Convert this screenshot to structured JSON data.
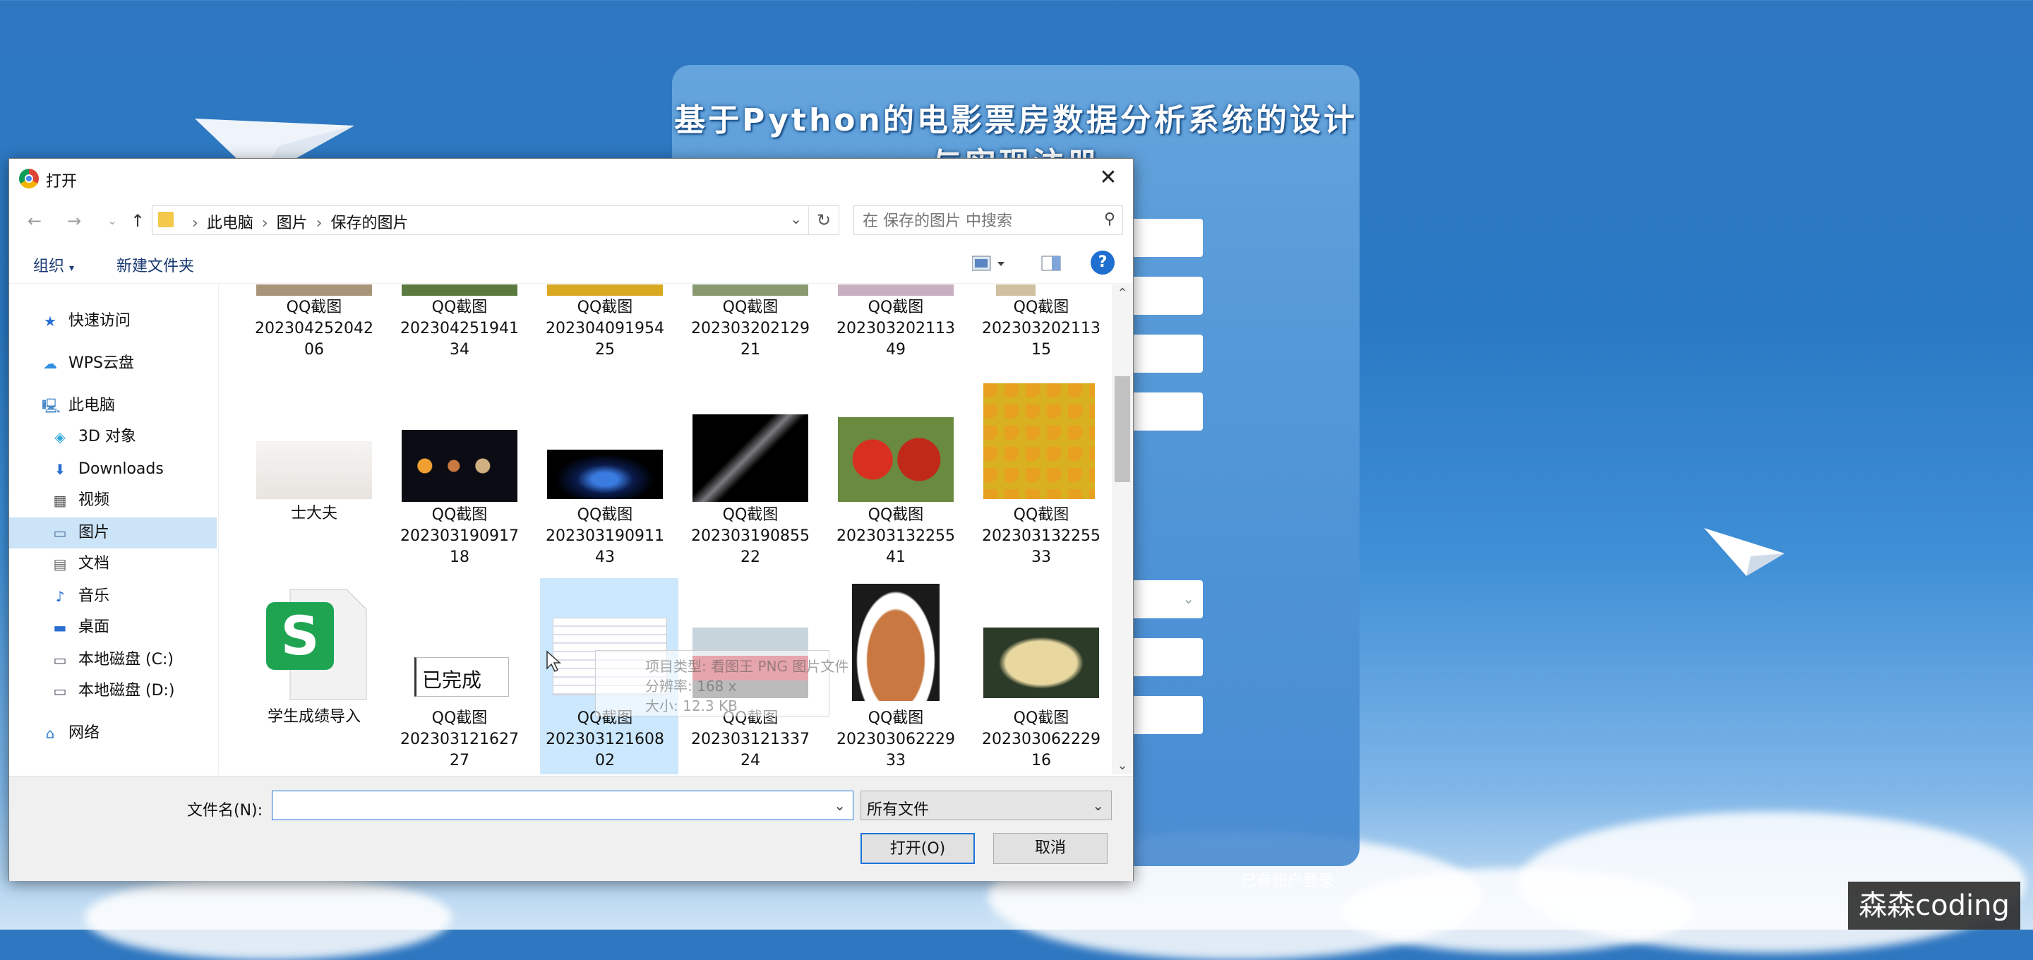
{
  "register": {
    "title": "基于Python的电影票房数据分析系统的设计与实现注册",
    "login_link": "已有账户登录"
  },
  "dialog": {
    "title": "打开",
    "address": [
      "此电脑",
      "图片",
      "保存的图片"
    ],
    "search_placeholder": "在 保存的图片 中搜索",
    "toolbar": {
      "organize": "组织",
      "new_folder": "新建文件夹"
    },
    "sidebar": [
      {
        "label": "快速访问",
        "icon": "star-icon"
      },
      {
        "label": "WPS云盘",
        "icon": "cloud-icon"
      },
      {
        "label": "此电脑",
        "icon": "computer-icon"
      },
      {
        "label": "3D 对象",
        "icon": "cube-icon"
      },
      {
        "label": "Downloads",
        "icon": "download-icon"
      },
      {
        "label": "视频",
        "icon": "video-icon"
      },
      {
        "label": "图片",
        "icon": "picture-icon"
      },
      {
        "label": "文档",
        "icon": "document-icon"
      },
      {
        "label": "音乐",
        "icon": "music-icon"
      },
      {
        "label": "桌面",
        "icon": "desktop-icon"
      },
      {
        "label": "本地磁盘 (C:)",
        "icon": "drive-icon"
      },
      {
        "label": "本地磁盘 (D:)",
        "icon": "drive-icon"
      },
      {
        "label": "网络",
        "icon": "network-icon"
      }
    ],
    "files_row1": [
      {
        "line1": "QQ截图",
        "line2": "202304252042",
        "line3": "06"
      },
      {
        "line1": "QQ截图",
        "line2": "202304251941",
        "line3": "34"
      },
      {
        "line1": "QQ截图",
        "line2": "202304091954",
        "line3": "25"
      },
      {
        "line1": "QQ截图",
        "line2": "202303202129",
        "line3": "21"
      },
      {
        "line1": "QQ截图",
        "line2": "202303202113",
        "line3": "49"
      },
      {
        "line1": "QQ截图",
        "line2": "202303202113",
        "line3": "15"
      }
    ],
    "files_row2": [
      {
        "line1": "士大夫",
        "line2": "",
        "line3": ""
      },
      {
        "line1": "QQ截图",
        "line2": "202303190917",
        "line3": "18"
      },
      {
        "line1": "QQ截图",
        "line2": "202303190911",
        "line3": "43"
      },
      {
        "line1": "QQ截图",
        "line2": "202303190855",
        "line3": "22"
      },
      {
        "line1": "QQ截图",
        "line2": "202303132255",
        "line3": "41"
      },
      {
        "line1": "QQ截图",
        "line2": "202303132255",
        "line3": "33"
      }
    ],
    "files_row3": [
      {
        "line1": "学生成绩导入",
        "line2": "",
        "line3": ""
      },
      {
        "line1": "QQ截图",
        "line2": "202303121627",
        "line3": "27"
      },
      {
        "line1": "QQ截图",
        "line2": "202303121608",
        "line3": "02"
      },
      {
        "line1": "QQ截图",
        "line2": "202303121337",
        "line3": "24"
      },
      {
        "line1": "QQ截图",
        "line2": "202303062229",
        "line3": "33"
      },
      {
        "line1": "QQ截图",
        "line2": "202303062229",
        "line3": "16"
      }
    ],
    "thumb_text_done": "已完成",
    "drag_tooltip": {
      "type": "项目类型: 看图王 PNG 图片文件",
      "size_dims": "分辨率: 168 x",
      "file_size": "大小: 12.3 KB"
    },
    "filename_label": "文件名(N):",
    "filename_value": "",
    "filetype": "所有文件",
    "open_button": "打开(O)",
    "cancel_button": "取消"
  },
  "watermark": "森森coding"
}
